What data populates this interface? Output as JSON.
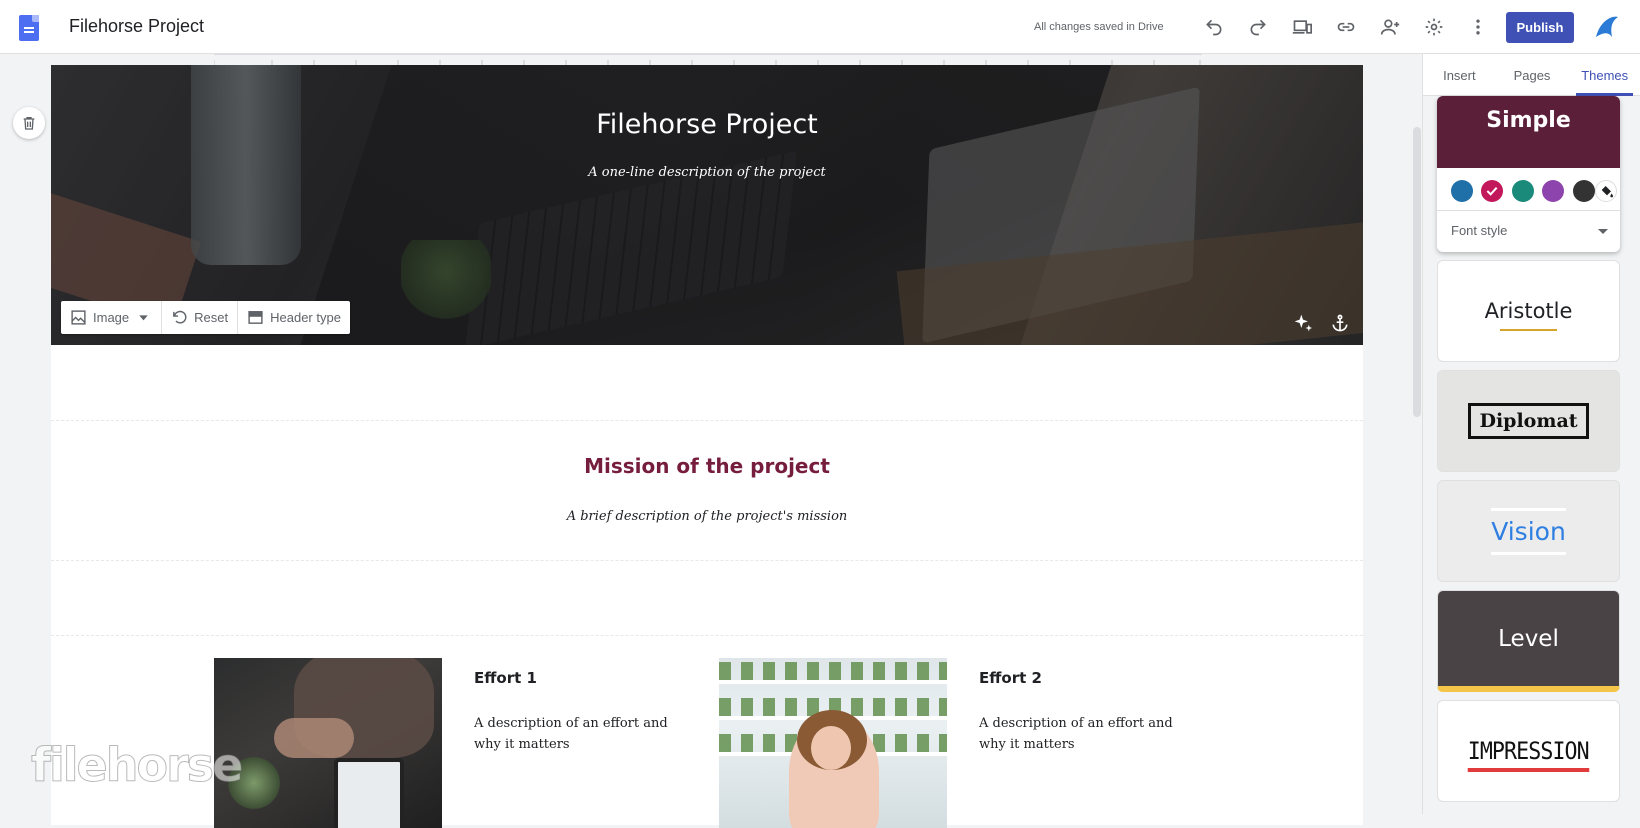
{
  "app": {
    "title": "Filehorse Project",
    "save_status": "All changes saved in Drive",
    "publish_label": "Publish"
  },
  "toolbar_icons": [
    "undo-icon",
    "redo-icon",
    "preview-devices-icon",
    "link-icon",
    "share-icon",
    "settings-icon",
    "more-icon"
  ],
  "header": {
    "site_title": "Filehorse Project",
    "site_description": "A one-line description of the project",
    "image_toolbar": {
      "image_label": "Image",
      "reset_label": "Reset",
      "header_type_label": "Header type"
    }
  },
  "mission": {
    "title": "Mission of the project",
    "description": "A brief description of the project's mission"
  },
  "efforts": [
    {
      "title": "Effort 1",
      "description": "A description of an effort and why it matters"
    },
    {
      "title": "Effort 2",
      "description": "A description of an effort and why it matters"
    }
  ],
  "watermark": "filehorse",
  "panel": {
    "tabs": [
      "Insert",
      "Pages",
      "Themes"
    ],
    "active_tab": "Themes",
    "themes": {
      "simple": {
        "name": "Simple",
        "swatches": [
          "#1f6fa8",
          "#c2185b",
          "#1a8b7a",
          "#8e44ad",
          "#333333"
        ],
        "selected_swatch": "#c2185b",
        "font_style_label": "Font style"
      },
      "others": [
        "Aristotle",
        "Diplomat",
        "Vision",
        "Level",
        "IMPRESSION"
      ]
    }
  },
  "colors": {
    "accent": "#3f51b5",
    "mission_title": "#761c3c",
    "simple_theme_bg": "#5b1f39"
  }
}
